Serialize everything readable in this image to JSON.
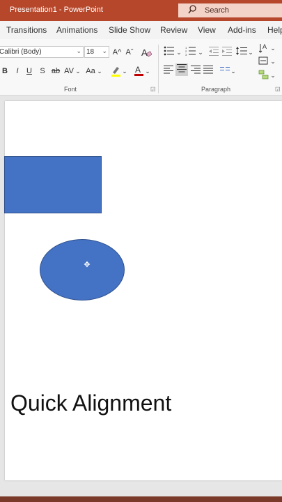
{
  "window": {
    "title": "Presentation1  -  PowerPoint",
    "search_placeholder": "Search"
  },
  "tabs": [
    "Transitions",
    "Animations",
    "Slide Show",
    "Review",
    "View",
    "Add-ins",
    "Help"
  ],
  "font_group": {
    "font_name": "Calibri (Body)",
    "font_size": "18",
    "grow_label": "A^",
    "shrink_label": "Aˇ",
    "bold": "B",
    "italic": "I",
    "underline": "U",
    "shadow": "S",
    "strike": "ab",
    "spacing": "AV",
    "case": "Aa",
    "font_color": "A",
    "label": "Font"
  },
  "paragraph_group": {
    "label": "Paragraph"
  },
  "slide": {
    "caption": "Quick Alignment",
    "shape_fill": "#4472c4",
    "shapes": [
      "rectangle",
      "ellipse"
    ]
  },
  "colors": {
    "accent": "#b7472a",
    "highlight": "#ffff00",
    "font_color": "#c00000"
  }
}
